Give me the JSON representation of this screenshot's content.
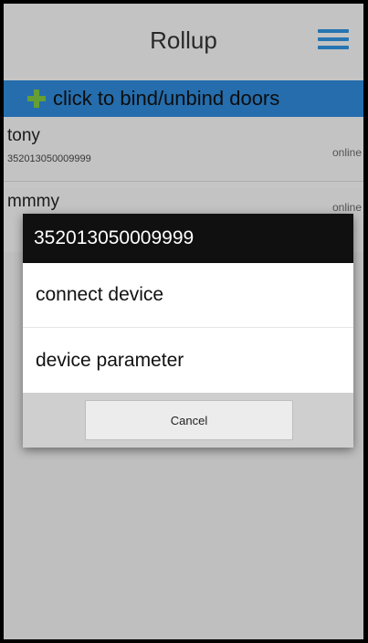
{
  "header": {
    "title": "Rollup",
    "menu_icon": "hamburger-menu-icon"
  },
  "bind_bar": {
    "icon": "plus-icon",
    "label": "click to bind/unbind doors"
  },
  "devices": [
    {
      "name": "tony",
      "id": "352013050009999",
      "status": "online"
    },
    {
      "name": "mmmy",
      "id": "",
      "status": "online"
    }
  ],
  "dialog": {
    "title": "352013050009999",
    "items": [
      {
        "label": "connect device"
      },
      {
        "label": "device parameter"
      }
    ],
    "cancel_label": "Cancel"
  },
  "colors": {
    "accent": "#2e86d3",
    "plus": "#7bc141",
    "dialog_title_bg": "#101010"
  }
}
